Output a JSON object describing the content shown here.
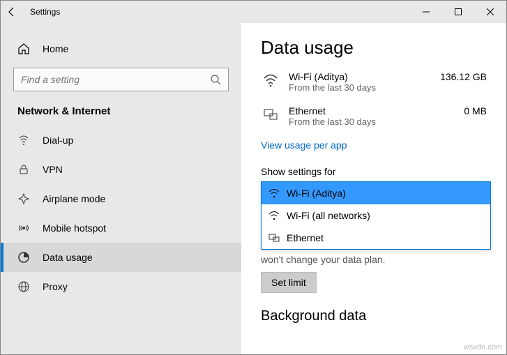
{
  "titlebar": {
    "title": "Settings"
  },
  "sidebar": {
    "home_label": "Home",
    "search_placeholder": "Find a setting",
    "section_label": "Network & Internet",
    "items": [
      {
        "label": "Dial-up"
      },
      {
        "label": "VPN"
      },
      {
        "label": "Airplane mode"
      },
      {
        "label": "Mobile hotspot"
      },
      {
        "label": "Data usage"
      },
      {
        "label": "Proxy"
      }
    ]
  },
  "main": {
    "title": "Data usage",
    "usage": [
      {
        "name": "Wi-Fi (Aditya)",
        "sub": "From the last 30 days",
        "value": "136.12 GB"
      },
      {
        "name": "Ethernet",
        "sub": "From the last 30 days",
        "value": "0 MB"
      }
    ],
    "link": "View usage per app",
    "field_label": "Show settings for",
    "dropdown": [
      {
        "label": "Wi-Fi (Aditya)"
      },
      {
        "label": "Wi-Fi (all networks)"
      },
      {
        "label": "Ethernet"
      }
    ],
    "truncated_text": "won't change your data plan.",
    "set_limit": "Set limit",
    "bg_heading": "Background data"
  },
  "watermark": "wsxdn.com"
}
